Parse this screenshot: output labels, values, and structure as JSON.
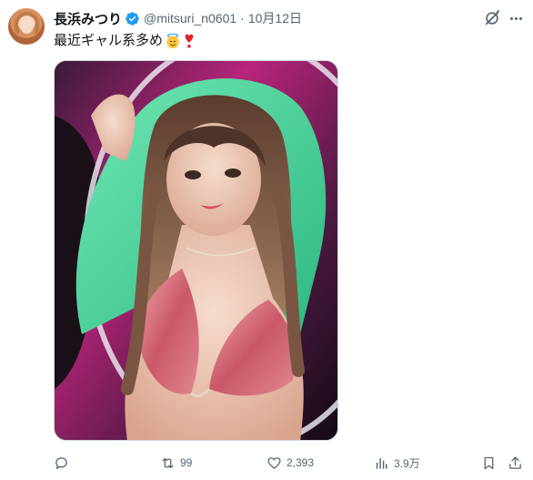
{
  "tweet": {
    "author_name": "長浜みつり",
    "handle": "@mitsuri_n0601",
    "separator": "·",
    "date": "10月12日",
    "text": "最近ギャル系多め",
    "emojis": [
      "angel-face-emoji",
      "heart-exclamation-emoji"
    ],
    "verified": true
  },
  "actions": {
    "replies": "",
    "reposts": "99",
    "likes": "2,393",
    "views": "3.9万"
  },
  "colors": {
    "verified_blue": "#1d9bf0",
    "secondary_text": "#536471",
    "primary_text": "#0f1419",
    "hoodie_green": "#4fd7a0",
    "bikini_pink": "#d9707c",
    "background_magenta": "#c2247c"
  },
  "media": {
    "description_alt": ""
  }
}
